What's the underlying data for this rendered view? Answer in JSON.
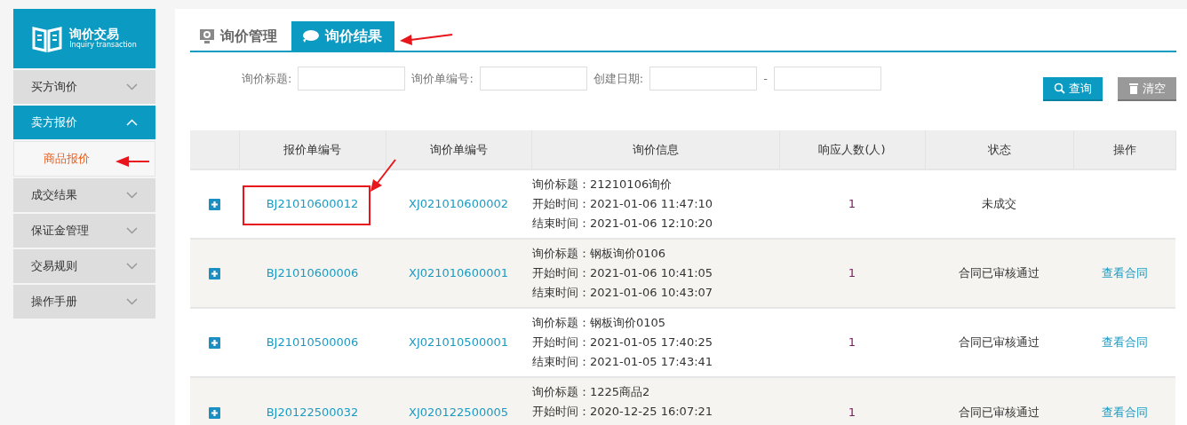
{
  "sidebar": {
    "logo": {
      "title": "询价交易",
      "subtitle": "Inquiry transaction"
    },
    "items": [
      {
        "label": "买方询价",
        "expanded": false
      },
      {
        "label": "卖方报价",
        "expanded": true,
        "children": [
          {
            "label": "商品报价",
            "selected": true
          }
        ]
      },
      {
        "label": "成交结果",
        "expanded": false
      },
      {
        "label": "保证金管理",
        "expanded": false
      },
      {
        "label": "交易规则",
        "expanded": false
      },
      {
        "label": "操作手册",
        "expanded": false
      }
    ]
  },
  "tabs": [
    {
      "label": "询价管理",
      "selected": false,
      "kind": "monitor"
    },
    {
      "label": "询价结果",
      "selected": true,
      "kind": "chat"
    }
  ],
  "filters": [
    {
      "label": "询价标题:"
    },
    {
      "label": "询价单编号:"
    },
    {
      "label": "创建日期:",
      "range_separator": "-"
    }
  ],
  "buttons": [
    {
      "label": "查询",
      "kind": "search"
    },
    {
      "label": "清空",
      "kind": "clear"
    }
  ],
  "table": {
    "columns": [
      "报价单编号",
      "询价单编号",
      "询价信息",
      "响应人数(人)",
      "状态",
      "操作"
    ],
    "rows": [
      {
        "expanded": false,
        "quote_no": "BJ21010600012",
        "inquiry_no": "XJ021010600002",
        "info": [
          "询价标题：21210106询价",
          "开始时间：2021-01-06 11:47:10",
          "结束时间：2021-01-06 12:10:20"
        ],
        "responders": "1",
        "status": "未成交"
      },
      {
        "expanded": false,
        "quote_no": "BJ21010600006",
        "inquiry_no": "XJ021010600001",
        "info": [
          "询价标题：钢板询价0106",
          "开始时间：2021-01-06 10:41:05",
          "结束时间：2021-01-06 10:43:07"
        ],
        "responders": "1",
        "status": "合同已审核通过",
        "action": "查看合同"
      },
      {
        "expanded": false,
        "quote_no": "BJ21010500006",
        "inquiry_no": "XJ021010500001",
        "info": [
          "询价标题：钢板询价0105",
          "开始时间：2021-01-05 17:40:25",
          "结束时间：2021-01-05 17:43:41"
        ],
        "responders": "1",
        "status": "合同已审核通过",
        "action": "查看合同"
      },
      {
        "expanded": false,
        "quote_no": "BJ20122500032",
        "inquiry_no": "XJ020122500005",
        "info": [
          "询价标题：1225商品2",
          "开始时间：2020-12-25 16:07:21"
        ],
        "responders": "1",
        "status": "合同已审核通过",
        "action": "查看合同"
      }
    ]
  }
}
